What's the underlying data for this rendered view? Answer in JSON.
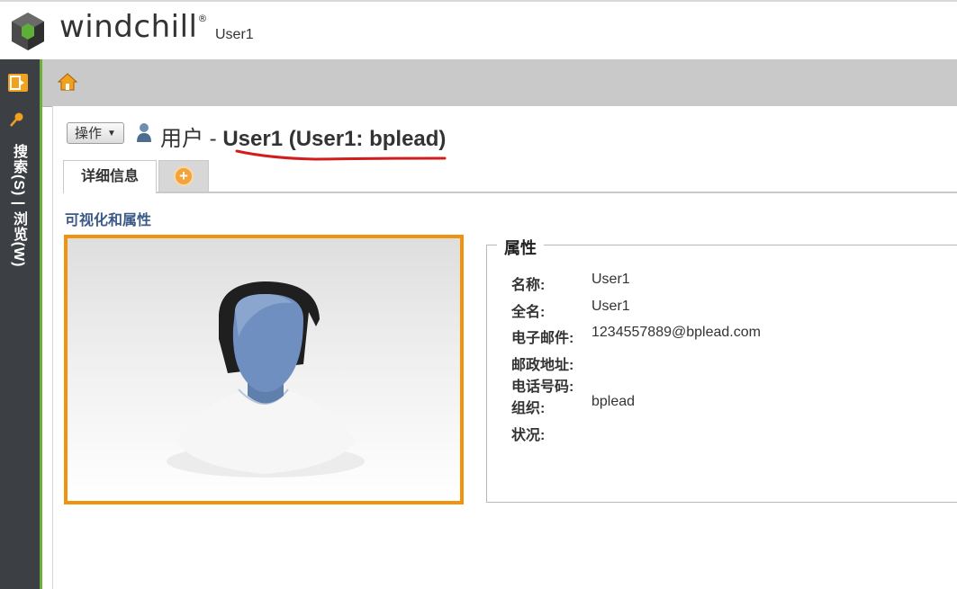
{
  "header": {
    "brand": "windchill",
    "brand_mark": "®",
    "username": "User1"
  },
  "rail": {
    "label": "搜索(S) | 浏览(W)"
  },
  "actions": {
    "label": "操作"
  },
  "title": {
    "prefix": "用户 - ",
    "name": "User1 (User1: bplead)"
  },
  "tabs": [
    {
      "label": "详细信息",
      "active": true
    },
    {
      "label": "+",
      "icon": "add-tab-icon"
    }
  ],
  "section": {
    "title": "可视化和属性"
  },
  "attributes": {
    "legend": "属性",
    "rows": [
      {
        "label": "名称:",
        "value": "User1"
      },
      {
        "label": "全名:",
        "value": "User1"
      },
      {
        "label": "电子邮件:",
        "value": "1234557889@bplead.com"
      },
      {
        "label": "邮政地址:",
        "value": ""
      },
      {
        "label": "电话号码:",
        "value": ""
      },
      {
        "label": "组织:",
        "value": "bplead"
      },
      {
        "label": "状况:",
        "value": ""
      }
    ]
  },
  "colors": {
    "accent_orange": "#f0930f",
    "rail_dark": "#3c3f43",
    "rail_green": "#6bb137",
    "section_title": "#3a5b87",
    "annotation_red": "#d11d1d"
  }
}
